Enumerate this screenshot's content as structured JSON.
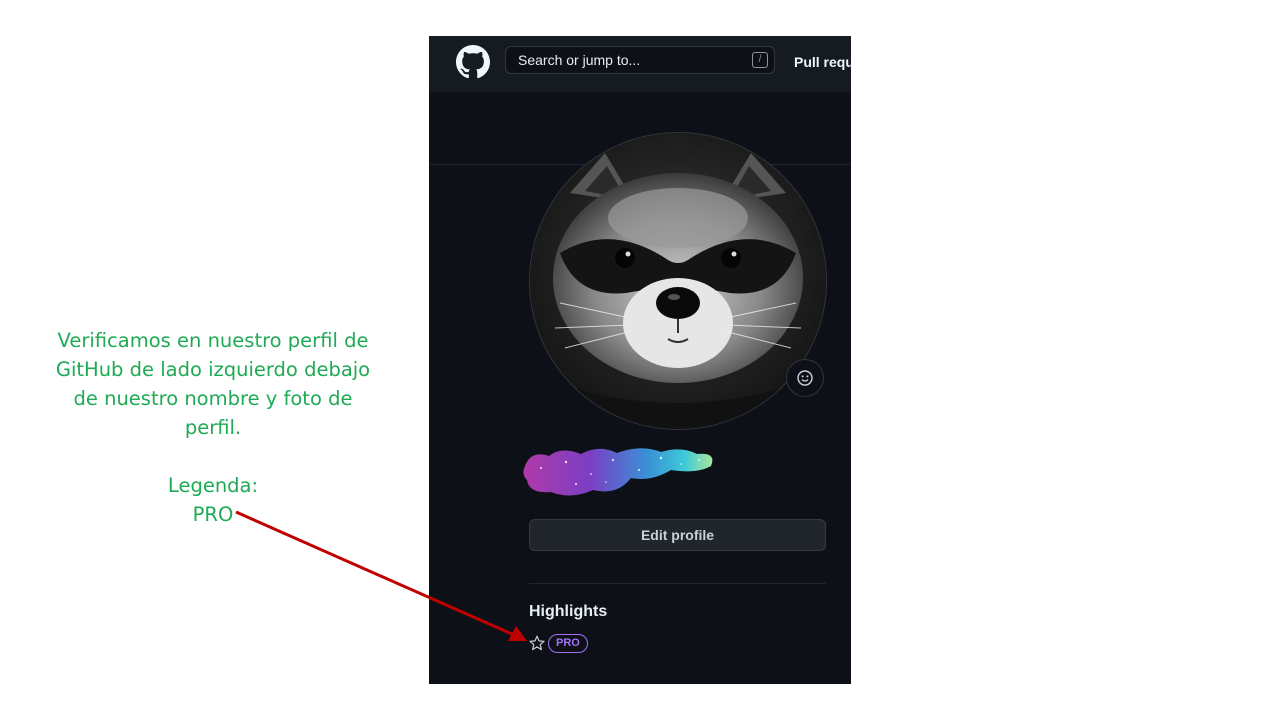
{
  "annotation": {
    "description_lines": [
      "Verificamos en nuestro perfil de",
      "GitHub de lado izquierdo debajo",
      "de nuestro nombre  y foto de",
      "perfil."
    ],
    "legend_label": "Legenda:",
    "legend_value": "PRO",
    "text_color": "#1faa55",
    "arrow_color": "#c00000"
  },
  "github": {
    "logo_icon": "github-octocat-icon",
    "search": {
      "placeholder": "Search or jump to...",
      "shortcut": "/"
    },
    "nav": {
      "pull_requests": "Pull requ"
    },
    "avatar": {
      "alt": "raccoon-photo"
    },
    "status_icon": "smiley-icon",
    "edit_profile_label": "Edit profile",
    "highlights": {
      "title": "Highlights",
      "star_icon": "star-icon",
      "badge": "PRO"
    },
    "colors": {
      "bg": "#0d1117",
      "header_bg": "#161b22",
      "button_bg": "#21262d",
      "badge": "#a371f7"
    }
  }
}
